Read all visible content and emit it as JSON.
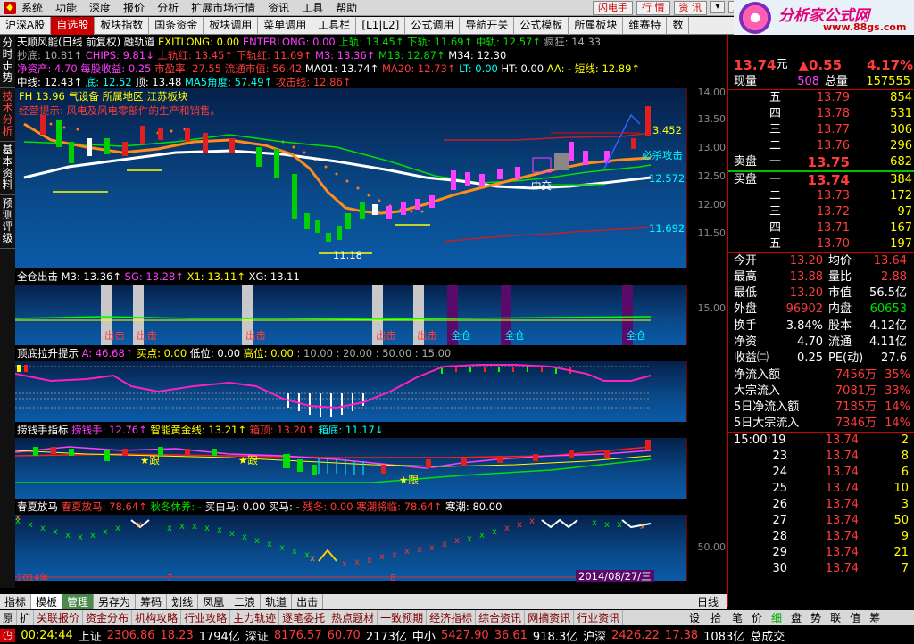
{
  "menubar": {
    "items": [
      "系统",
      "功能",
      "深度",
      "报价",
      "分析",
      "扩展市场行情",
      "资讯",
      "工具",
      "帮助"
    ],
    "right": [
      "闪电手",
      "行 情",
      "资 讯"
    ],
    "sys": [
      "▾",
      "_",
      "▫",
      "×"
    ]
  },
  "logo": {
    "text": "分析家公式网",
    "url": "www.88gs.com"
  },
  "tabbar": [
    "沪深A股",
    "自选股",
    "板块指数",
    "国条资金",
    "板块调用",
    "菜单调用",
    "工具栏",
    "[L1|L2]",
    "公式调用",
    "导航开关",
    "公式模板",
    "所属板块",
    "维赛特",
    "数"
  ],
  "sidetabs": [
    "分时走势",
    "技术分析",
    "基本资料",
    "预测评级"
  ],
  "main_panel": {
    "title": "天顺风能(日线 前复权) 融轨道",
    "line1": [
      {
        "t": "EXITLONG: 0.00",
        "c": "yel"
      },
      {
        "t": "ENTERLONG: 0.00",
        "c": "mag"
      },
      {
        "t": "上轨: 13.45↑",
        "c": "grn"
      },
      {
        "t": "下轨: 11.69↑",
        "c": "grn"
      },
      {
        "t": "中轨: 12.57↑",
        "c": "grn"
      },
      {
        "t": "疯狂: 14.33",
        "c": "gry"
      }
    ],
    "line2": [
      {
        "t": "抄底: 10.81↑",
        "c": "gry"
      },
      {
        "t": "CHIPS: 9.81↓",
        "c": "mag"
      },
      {
        "t": "上轨红: 13.45↑",
        "c": "red"
      },
      {
        "t": "下轨红: 11.69↑",
        "c": "red"
      },
      {
        "t": "M3: 13.36↑",
        "c": "mag"
      },
      {
        "t": "M13: 12.87↑",
        "c": "grn"
      },
      {
        "t": "M34: 12.30",
        "c": "wht"
      }
    ],
    "line3": [
      {
        "t": "净资产: 4.70",
        "c": "mag"
      },
      {
        "t": "每股收益: 0.25",
        "c": "mag"
      },
      {
        "t": "市盈率: 27.55",
        "c": "red"
      },
      {
        "t": "流通市值: 56.42",
        "c": "red"
      },
      {
        "t": "MA01: 13.74↑",
        "c": "wht"
      },
      {
        "t": "MA20: 12.73↑",
        "c": "red"
      },
      {
        "t": "LT: 0.00",
        "c": "cyan"
      },
      {
        "t": "HT: 0.00",
        "c": "wht"
      },
      {
        "t": "AA: - 短线: 12.89↑",
        "c": "yel"
      }
    ],
    "line4": [
      {
        "t": "中线: 12.43↑",
        "c": "wht"
      },
      {
        "t": "底: 12.52",
        "c": "cyan"
      },
      {
        "t": "顶: 13.48",
        "c": "wht"
      },
      {
        "t": "MA5角度: 57.49↑",
        "c": "cyan"
      },
      {
        "t": "攻击线: 12.86↑",
        "c": "red"
      }
    ],
    "annot1": "FH 13.96 气设备 所属地区:江苏板块",
    "annot2": "经营提示: 风电及风电零部件的生产和销售。",
    "labels": {
      "hi": "3.452",
      "mid": "12.572",
      "lo": "11.692",
      "low": "11.18",
      "tip": "必杀攻击",
      "mid2": "中交"
    },
    "yticks": [
      "14.00",
      "13.50",
      "13.00",
      "12.50",
      "12.00",
      "11.50"
    ]
  },
  "p1": {
    "title": "全仓出击",
    "fields": [
      {
        "t": "M3: 13.36↑",
        "c": "wht"
      },
      {
        "t": "SG: 13.28↑",
        "c": "mag"
      },
      {
        "t": "X1: 13.11↑",
        "c": "yel"
      },
      {
        "t": "XG: 13.11",
        "c": "wht"
      }
    ],
    "tick": "15.00",
    "out_label": "出击",
    "all_label": "全仓"
  },
  "p2": {
    "title": "顶底拉升提示",
    "fields": [
      {
        "t": "A: 46.68↑",
        "c": "mag"
      },
      {
        "t": "买点: 0.00",
        "c": "yel"
      },
      {
        "t": "低位: 0.00",
        "c": "wht"
      },
      {
        "t": "高位: 0.00",
        "c": "yel"
      },
      {
        "t": ": 10.00 : 20.00 : 50.00 : 15.00",
        "c": "gry"
      }
    ]
  },
  "p3": {
    "title": "捞钱手指标",
    "fields": [
      {
        "t": "捞钱手: 12.76↑",
        "c": "mag"
      },
      {
        "t": "智能黄金线: 13.21↑",
        "c": "yel"
      },
      {
        "t": "箱顶: 13.20↑",
        "c": "red"
      },
      {
        "t": "箱底: 11.17↓",
        "c": "cyan"
      }
    ],
    "follow": "跟"
  },
  "p4": {
    "title": "春夏放马",
    "fields": [
      {
        "t": "春夏放马: 78.64↑",
        "c": "red"
      },
      {
        "t": "秋冬休养: -",
        "c": "grn"
      },
      {
        "t": "买白马: 0.00",
        "c": "wht"
      },
      {
        "t": "买马: -",
        "c": "wht"
      },
      {
        "t": "残冬: 0.00",
        "c": "red"
      },
      {
        "t": "寒潮将临: 78.64↑",
        "c": "red"
      },
      {
        "t": "寒潮: 80.00",
        "c": "wht"
      }
    ],
    "tick": "50.00",
    "year": "2014年",
    "m1": "7",
    "m2": "8",
    "date": "2014/08/27/三"
  },
  "quote": {
    "name": "天顺风能",
    "code": "002531",
    "price": "13.74",
    "unit": "元",
    "chg": "▲0.55",
    "pct": "4.17%",
    "xianliang_label": "现量",
    "xianliang": "508",
    "zongliang_label": "总量",
    "zongliang": "157555",
    "asks": [
      {
        "l": "五",
        "p": "13.79",
        "v": "854"
      },
      {
        "l": "四",
        "p": "13.78",
        "v": "531"
      },
      {
        "l": "三",
        "p": "13.77",
        "v": "306"
      },
      {
        "l": "二",
        "p": "13.76",
        "v": "296"
      },
      {
        "l": "一",
        "p": "13.75",
        "v": "682"
      }
    ],
    "ask_label": "卖盘",
    "bid_label": "买盘",
    "bids": [
      {
        "l": "一",
        "p": "13.74",
        "v": "384"
      },
      {
        "l": "二",
        "p": "13.73",
        "v": "172"
      },
      {
        "l": "三",
        "p": "13.72",
        "v": "97"
      },
      {
        "l": "四",
        "p": "13.71",
        "v": "167"
      },
      {
        "l": "五",
        "p": "13.70",
        "v": "197"
      }
    ],
    "stats": [
      [
        "今开",
        "13.20",
        "均价",
        "13.64"
      ],
      [
        "最高",
        "13.88",
        "量比",
        "2.88"
      ],
      [
        "最低",
        "13.20",
        "市值",
        "56.5亿"
      ],
      [
        "外盘",
        "96902",
        "内盘",
        "60653"
      ]
    ],
    "stats2": [
      [
        "换手",
        "3.84%",
        "股本",
        "4.12亿"
      ],
      [
        "净资",
        "4.70",
        "流通",
        "4.11亿"
      ],
      [
        "收益㈡",
        "0.25",
        "PE(动)",
        "27.6"
      ]
    ],
    "flows": [
      [
        "净流入额",
        "7456万",
        "35%"
      ],
      [
        "大宗流入",
        "7081万",
        "33%"
      ],
      [
        "5日净流入额",
        "7185万",
        "14%"
      ],
      [
        "5日大宗流入",
        "7346万",
        "14%"
      ]
    ],
    "ticks": [
      [
        "15:00:19",
        "13.74",
        "2"
      ],
      [
        "23",
        "13.74",
        "8"
      ],
      [
        "24",
        "13.74",
        "6"
      ],
      [
        "25",
        "13.74",
        "10"
      ],
      [
        "26",
        "13.74",
        "3"
      ],
      [
        "27",
        "13.74",
        "50"
      ],
      [
        "28",
        "13.74",
        "9"
      ],
      [
        "29",
        "13.74",
        "21"
      ],
      [
        "30",
        "13.74",
        "7"
      ]
    ]
  },
  "btabs1": [
    "指标",
    "模板",
    "管理",
    "另存为",
    "筹码",
    "划线",
    "凤凰",
    "二浪",
    "轨道",
    "出击"
  ],
  "btabs1_right": "日线",
  "btabs2": [
    "原",
    "扩",
    "关联报价",
    "资金分布",
    "机构攻略",
    "行业攻略",
    "主力轨迹",
    "逐笔委托",
    "热点题材",
    "一致预期",
    "经济指标",
    "综合资讯",
    "网摘资讯",
    "行业资讯"
  ],
  "btabs2_right": [
    "设",
    "拾"
  ],
  "rptabs": [
    "笔",
    "价",
    "细",
    "盘",
    "势",
    "联",
    "值",
    "筹"
  ],
  "status": {
    "time": "00:24:44",
    "sh_label": "上证",
    "sh": "2306.86",
    "sh_chg": "18.23",
    "sh_amt": "1794亿",
    "sz_label": "深证",
    "sz": "8176.57",
    "sz_chg": "60.70",
    "sz_amt": "2173亿",
    "zx_label": "中小",
    "zx": "5427.90",
    "zx_chg": "36.61",
    "zx_amt": "918.3亿",
    "hs_label": "沪深",
    "hs": "2426.22",
    "hs_chg": "17.38",
    "hs_amt": "1083亿",
    "last": "总成交"
  }
}
